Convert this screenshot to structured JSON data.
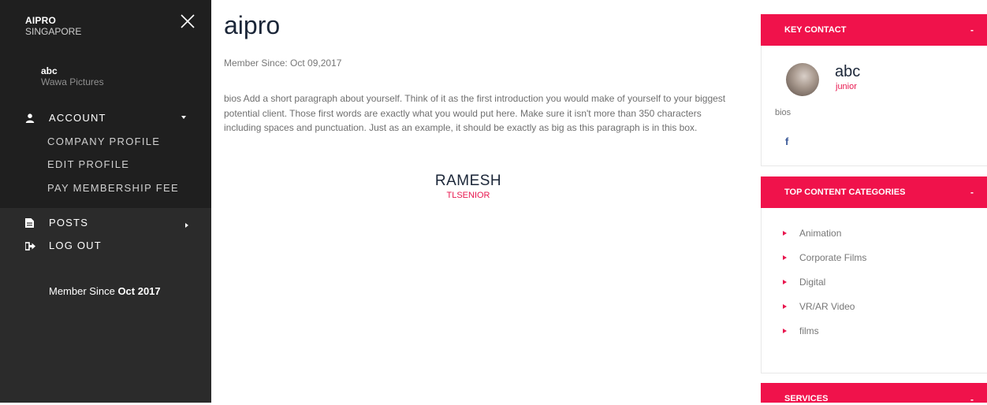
{
  "sidebar": {
    "brand_name": "AIPRO",
    "brand_location": "SINGAPORE",
    "user_name": "abc",
    "user_org": "Wawa Pictures",
    "menu": {
      "account_label": "ACCOUNT",
      "account_items": [
        "COMPANY PROFILE",
        "EDIT PROFILE",
        "PAY MEMBERSHIP FEE"
      ],
      "posts_label": "POSTS",
      "logout_label": "LOG OUT"
    },
    "member_since_prefix": "Member Since",
    "member_since_value": "Oct 2017"
  },
  "main": {
    "title": "aipro",
    "member_since": "Member Since: Oct 09,2017",
    "bio": "bios Add a short paragraph about yourself. Think of it as the first introduction you would make of yourself to your biggest potential client. Those first words are exactly what you would put here. Make sure it isn't more than 350 characters including spaces and punctuation. Just as an example, it should be exactly as big as this paragraph is in this box.",
    "rm_name": "RAMESH",
    "rm_role": "TLSENIOR"
  },
  "right": {
    "key_contact": {
      "title": "KEY CONTACT",
      "toggle": "-",
      "name": "abc",
      "role": "junior",
      "bios": "bios",
      "social_icon": "f"
    },
    "top_categories": {
      "title": "TOP CONTENT CATEGORIES",
      "toggle": "-",
      "items": [
        "Animation",
        "Corporate Films",
        "Digital",
        "VR/AR Video",
        "films"
      ]
    },
    "services": {
      "title": "SERVICES",
      "toggle": "-"
    }
  },
  "colors": {
    "accent": "#f0124b",
    "sidebar_bg": "#2b2b2b",
    "sidebar_dark": "#1f1f1f",
    "title_text": "#1b2638"
  }
}
